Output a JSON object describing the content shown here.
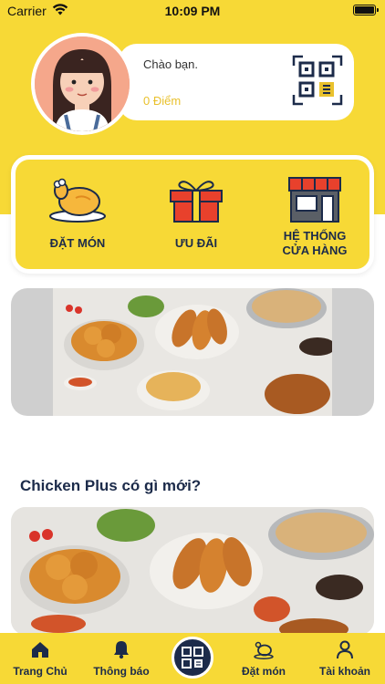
{
  "status_bar": {
    "carrier": "Carrier",
    "time": "10:09 PM"
  },
  "profile": {
    "greeting": "Chào bạn.",
    "points": "0 Điểm"
  },
  "menu": {
    "items": [
      {
        "label": "ĐẶT MÓN",
        "icon": "fried-chicken-icon"
      },
      {
        "label": "ƯU ĐÃI",
        "icon": "gift-box-icon"
      },
      {
        "label_line1": "HỆ THỐNG",
        "label_line2": "CỬA HÀNG",
        "icon": "store-icon"
      }
    ]
  },
  "news": {
    "title": "Chicken Plus có gì mới?"
  },
  "tab_bar": {
    "items": [
      {
        "label": "Trang Chủ",
        "icon": "home-icon"
      },
      {
        "label": "Thông báo",
        "icon": "bell-icon"
      },
      {
        "label": "",
        "icon": "qr-code-icon"
      },
      {
        "label": "Đặt món",
        "icon": "order-chicken-icon"
      },
      {
        "label": "Tài khoản",
        "icon": "user-icon"
      }
    ]
  },
  "colors": {
    "brand_yellow": "#f7d936",
    "navy": "#1c2b4a",
    "points_gold": "#e9c12d",
    "gift_red": "#e8412c"
  }
}
